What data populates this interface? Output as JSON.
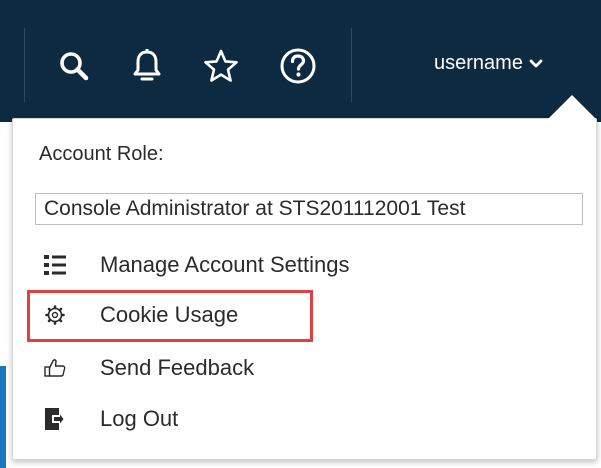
{
  "header": {
    "username": "username",
    "icons": [
      "search-icon",
      "bell-icon",
      "star-icon",
      "help-icon",
      "chevron-down-icon"
    ],
    "background_color": "#0d2a40"
  },
  "account_menu": {
    "role_label": "Account Role:",
    "role_value": "Console Administrator at STS201112001 Test",
    "items": [
      {
        "label": "Manage Account Settings",
        "icon": "list-icon"
      },
      {
        "label": "Cookie Usage",
        "icon": "gear-icon"
      },
      {
        "label": "Send Feedback",
        "icon": "thumbs-up-icon"
      },
      {
        "label": "Log Out",
        "icon": "logout-icon"
      }
    ],
    "highlight_color": "#e0403f"
  }
}
